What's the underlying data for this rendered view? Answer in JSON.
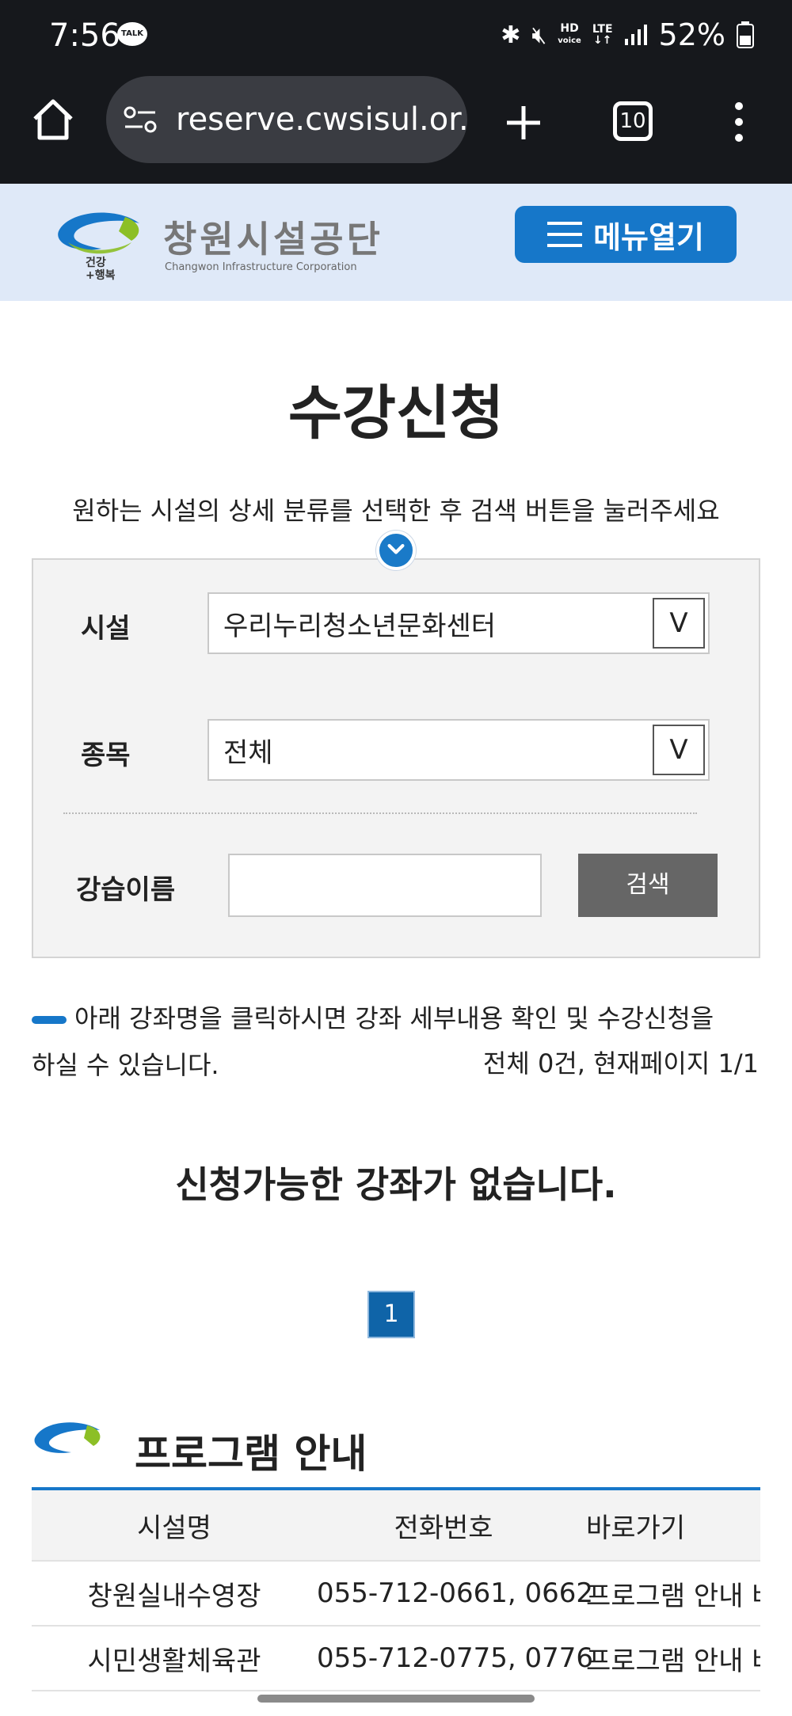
{
  "status_bar": {
    "time": "7:56",
    "talk_badge": "TALK",
    "hd_voice": "HD",
    "voice": "voice",
    "lte": "LTE",
    "battery": "52%"
  },
  "browser": {
    "url": "reserve.cwsisul.or.kr",
    "tab_count": "10"
  },
  "site_header": {
    "logo_title": "창원시설공단",
    "logo_subtitle": "Changwon Infrastructure Corporation",
    "menu_label": "메뉴열기"
  },
  "page": {
    "title": "수강신청",
    "guide": "원하는 시설의 상세 분류를 선택한 후 검색 버튼을 눌러주세요"
  },
  "search_form": {
    "facility_label": "시설",
    "facility_value": "우리누리청소년문화센터",
    "category_label": "종목",
    "category_value": "전체",
    "dropdown_arrow": "V",
    "course_label": "강습이름",
    "course_value": "",
    "search_button": "검색"
  },
  "notice": {
    "line1": "아래 강좌명을 클릭하시면 강좌 세부내용 확인 및 수강신청을",
    "line2": "하실 수 있습니다.",
    "count": "전체 0건, 현재페이지 1/1"
  },
  "results": {
    "empty_message": "신청가능한 강좌가 없습니다."
  },
  "pagination": {
    "current": "1"
  },
  "program_section": {
    "title": "프로그램 안내",
    "headers": [
      "시설명",
      "전화번호",
      "바로가기"
    ],
    "rows": [
      {
        "name": "창원실내수영장",
        "phone": "055-712-0661, 0662",
        "link": "프로그램 안내 바로가기"
      },
      {
        "name": "시민생활체육관",
        "phone": "055-712-0775, 0776",
        "link": "프로그램 안내 바로가기"
      }
    ]
  },
  "colors": {
    "accent": "#1677c9",
    "header_bg": "#dfe9f8",
    "status_bg": "#16181c",
    "search_button_bg": "#666666"
  }
}
